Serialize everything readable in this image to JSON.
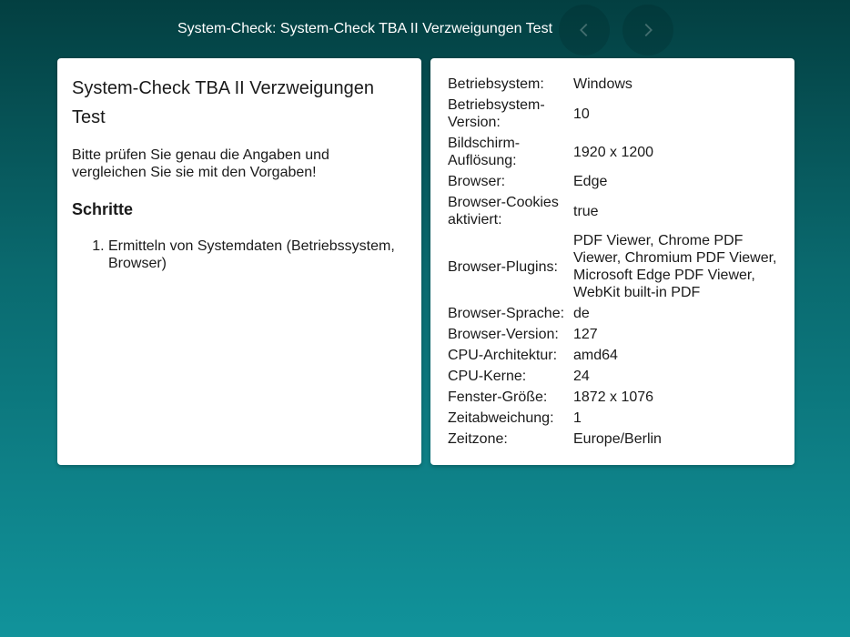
{
  "header": {
    "title": "System-Check: System-Check TBA II Verzweigungen Test",
    "prev_icon": "chevron-left-icon",
    "next_icon": "chevron-right-icon"
  },
  "main": {
    "title": "System-Check TBA II Verzweigungen Test",
    "description": "Bitte prüfen Sie genau die Angaben und vergleichen Sie sie mit den Vorgaben!",
    "steps_heading": "Schritte",
    "steps": [
      "Ermitteln von Systemdaten (Betriebssystem, Browser)"
    ]
  },
  "info": {
    "rows": [
      {
        "label": "Betriebsystem:",
        "value": "Windows"
      },
      {
        "label": "Betriebsystem-Version:",
        "value": "10"
      },
      {
        "label": "Bildschirm-Auflösung:",
        "value": "1920 x 1200"
      },
      {
        "label": "Browser:",
        "value": "Edge"
      },
      {
        "label": "Browser-Cookies aktiviert:",
        "value": "true"
      },
      {
        "label": "Browser-Plugins:",
        "value": "PDF Viewer, Chrome PDF Viewer, Chromium PDF Viewer, Microsoft Edge PDF Viewer, WebKit built-in PDF"
      },
      {
        "label": "Browser-Sprache:",
        "value": "de"
      },
      {
        "label": "Browser-Version:",
        "value": "127"
      },
      {
        "label": "CPU-Architektur:",
        "value": "amd64"
      },
      {
        "label": "CPU-Kerne:",
        "value": "24"
      },
      {
        "label": "Fenster-Größe:",
        "value": "1872 x 1076"
      },
      {
        "label": "Zeitabweichung:",
        "value": "1"
      },
      {
        "label": "Zeitzone:",
        "value": "Europe/Berlin"
      }
    ]
  },
  "colors": {
    "background_top": "#033f41",
    "background_bottom": "#11939b",
    "card": "#ffffff"
  }
}
